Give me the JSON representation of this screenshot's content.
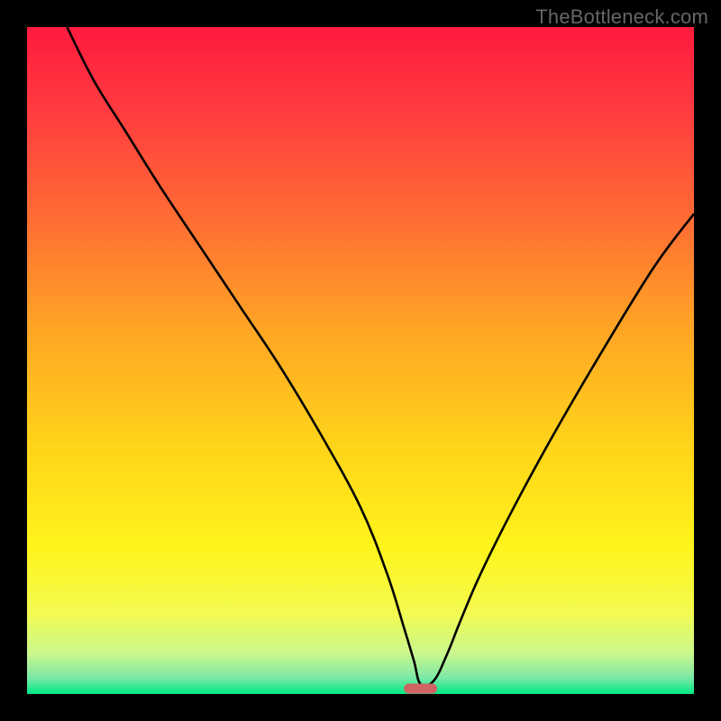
{
  "watermark": "TheBottleneck.com",
  "chart_data": {
    "type": "line",
    "title": "",
    "xlabel": "",
    "ylabel": "",
    "xlim": [
      0,
      100
    ],
    "ylim": [
      0,
      100
    ],
    "background_gradient_stops": [
      {
        "offset": 0.0,
        "color": "#ff1a3d"
      },
      {
        "offset": 0.12,
        "color": "#ff3a40"
      },
      {
        "offset": 0.28,
        "color": "#ff6a34"
      },
      {
        "offset": 0.45,
        "color": "#ffa425"
      },
      {
        "offset": 0.62,
        "color": "#ffd21a"
      },
      {
        "offset": 0.78,
        "color": "#fff41b"
      },
      {
        "offset": 0.88,
        "color": "#f3fb52"
      },
      {
        "offset": 0.94,
        "color": "#c9f78d"
      },
      {
        "offset": 0.975,
        "color": "#7ee9a6"
      },
      {
        "offset": 1.0,
        "color": "#00e888"
      }
    ],
    "series": [
      {
        "name": "bottleneck-curve",
        "x": [
          6,
          10,
          15,
          20,
          26,
          32,
          38,
          44,
          50,
          54,
          56.5,
          58,
          59,
          61,
          63,
          65,
          68,
          73,
          79,
          86,
          94,
          100
        ],
        "y": [
          100,
          92,
          84,
          76,
          67,
          58,
          49,
          39,
          28,
          18,
          10,
          5,
          1.5,
          2,
          6,
          11,
          18,
          28,
          39,
          51,
          64,
          72
        ]
      }
    ],
    "marker": {
      "name": "bottleneck-marker",
      "x": 59,
      "y": 0.8,
      "width_pct": 5,
      "height_pct": 1.5,
      "color": "#d06464"
    }
  }
}
